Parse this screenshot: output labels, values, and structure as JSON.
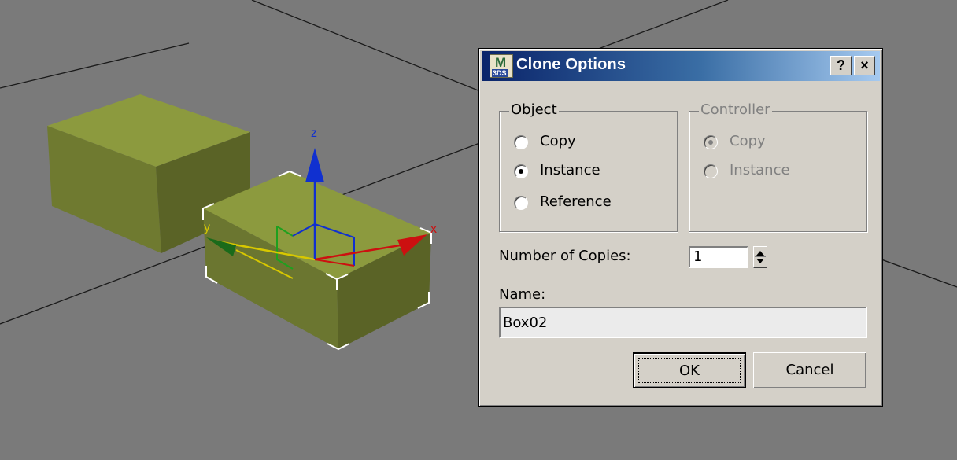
{
  "viewport": {
    "gizmo_axes": {
      "z": "z",
      "x": "x",
      "y": "y"
    }
  },
  "dialog": {
    "title": "Clone Options",
    "app_icon": {
      "letter": "M",
      "caption": "3DS"
    },
    "help_button": "?",
    "close_button": "×",
    "object_group": {
      "label": "Object",
      "options": [
        "Copy",
        "Instance",
        "Reference"
      ],
      "selected": "Instance"
    },
    "controller_group": {
      "label": "Controller",
      "options": [
        "Copy",
        "Instance"
      ],
      "selected": "Copy",
      "enabled": false
    },
    "copies": {
      "label": "Number of Copies:",
      "value": "1"
    },
    "name": {
      "label": "Name:",
      "value": "Box02"
    },
    "ok_label": "OK",
    "cancel_label": "Cancel"
  },
  "colors": {
    "viewport_bg": "#7a7a7a",
    "box_top": "#8c9a3e",
    "box_side": "#6f7a30",
    "box_front": "#5c6528",
    "dialog_bg": "#d4d0c8",
    "titlebar_start": "#0a246a",
    "titlebar_end": "#a6caf0",
    "axis_x": "#cc1010",
    "axis_y": "#d8c800",
    "axis_z": "#1030d0",
    "axis_y_head": "#1a6a1a"
  }
}
